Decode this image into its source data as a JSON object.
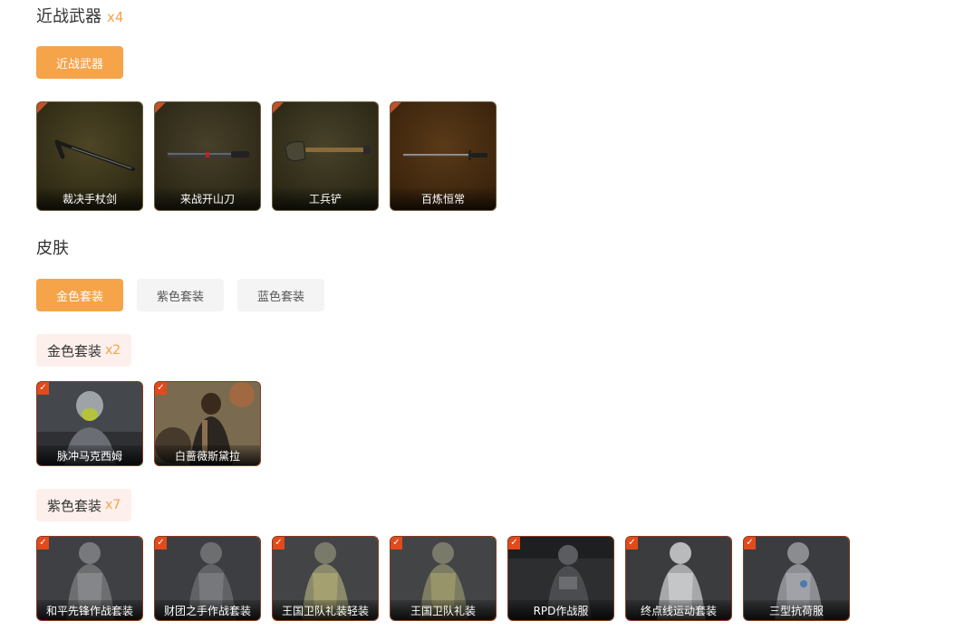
{
  "melee": {
    "title": "近战武器",
    "count": "x4",
    "tab": "近战武器",
    "items": [
      {
        "name": "裁决手杖剑",
        "icon": "cane-sword-icon"
      },
      {
        "name": "来战开山刀",
        "icon": "machete-icon"
      },
      {
        "name": "工兵铲",
        "icon": "shovel-icon"
      },
      {
        "name": "百炼恒常",
        "icon": "sword-icon"
      }
    ]
  },
  "skin": {
    "title": "皮肤",
    "tabs": [
      "金色套装",
      "紫色套装",
      "蓝色套装"
    ],
    "active_tab": "金色套装"
  },
  "gold_group": {
    "label": "金色套装",
    "count": "x2",
    "items": [
      {
        "name": "脉冲马克西姆"
      },
      {
        "name": "白蔷薇斯黛拉"
      }
    ]
  },
  "purple_group": {
    "label": "紫色套装",
    "count": "x7",
    "items": [
      {
        "name": "和平先锋作战套装"
      },
      {
        "name": "财团之手作战套装"
      },
      {
        "name": "王国卫队礼装轻装"
      },
      {
        "name": "王国卫队礼装"
      },
      {
        "name": "RPD作战服"
      },
      {
        "name": "终点线运动套装"
      },
      {
        "name": "三型抗荷服"
      }
    ]
  },
  "colors": {
    "accent": "#f5a44a",
    "check": "#e24a1c"
  }
}
